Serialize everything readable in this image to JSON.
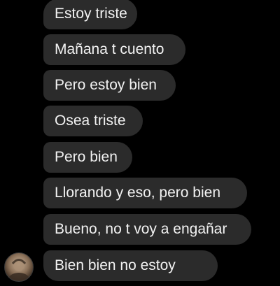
{
  "messages": [
    {
      "text": "Estoy triste"
    },
    {
      "text": "Mañana t cuento"
    },
    {
      "text": "Pero estoy bien"
    },
    {
      "text": "Osea triste"
    },
    {
      "text": "Pero bien"
    },
    {
      "text": "Llorando y eso, pero bien"
    },
    {
      "text": "Bueno, no t voy a engañar"
    },
    {
      "text": "Bien bien no estoy"
    }
  ],
  "colors": {
    "background": "#000000",
    "bubble": "#2b2b2b",
    "text": "#f2f2f2"
  },
  "avatar": {
    "icon": "user-avatar-photo"
  }
}
